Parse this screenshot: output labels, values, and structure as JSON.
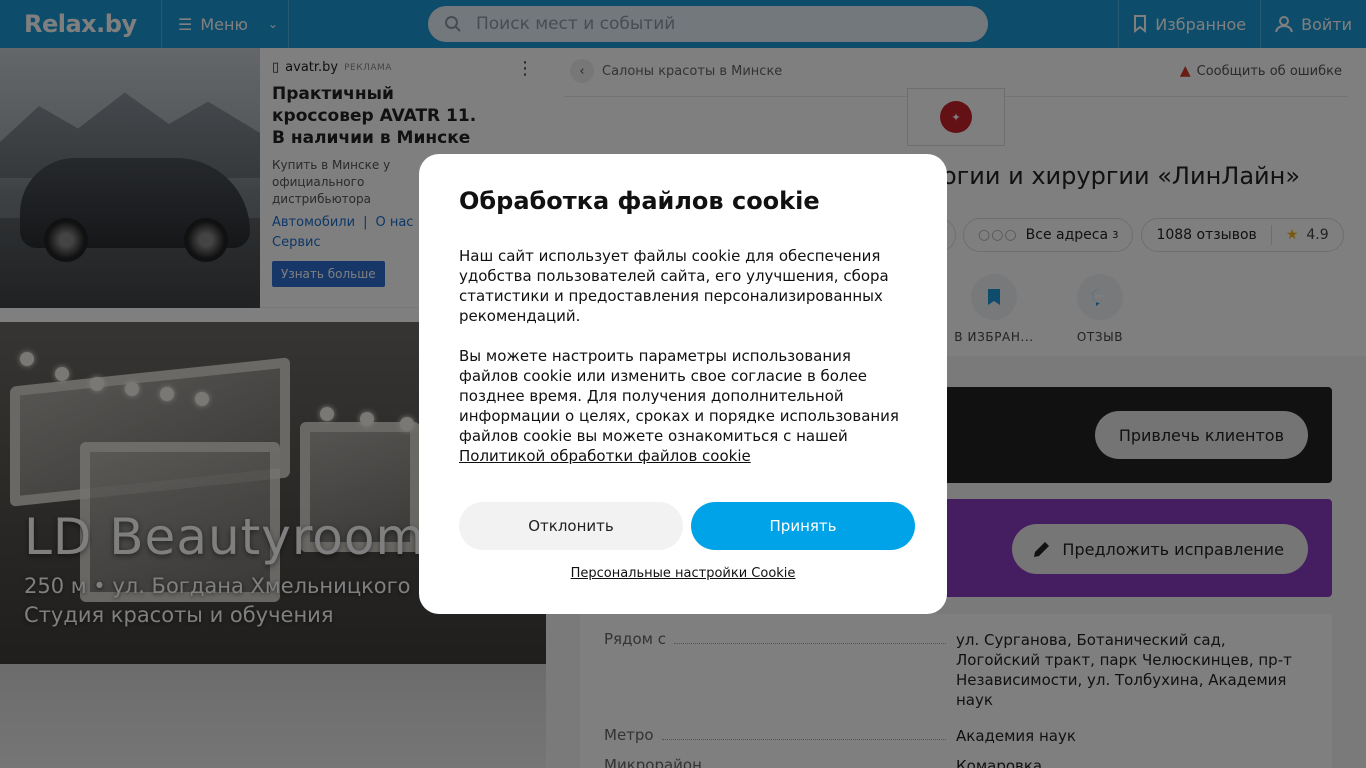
{
  "header": {
    "logo": "Relax.by",
    "menu_label": "Меню",
    "search_placeholder": "Поиск мест и событий",
    "favorites_label": "Избранное",
    "login_label": "Войти"
  },
  "ad": {
    "source": "avatr.by",
    "tag": "РЕКЛАМА",
    "title": "Практичный кроссовер AVATR 11. В наличии в Минске",
    "description": "Купить в Минске у официального дистрибьютора АВТОВЕК лет",
    "links": [
      "Автомобили",
      "О нас",
      "Сервис"
    ],
    "cta": "Узнать больше"
  },
  "feature": {
    "title": "LD Beautyroom",
    "subtitle_line1": "250 м • ул. Богдана Хмельницкого",
    "subtitle_line2": "Студия красоты и обучения"
  },
  "place": {
    "breadcrumb": "Салоны красоты в Минске",
    "report": "Сообщить об ошибке",
    "title": "огии и хирургии «ЛинЛайн»",
    "chips": {
      "addresses_label": "Все адреса",
      "addresses_count": "3",
      "reviews": "1088 отзывов",
      "rating": "4.9"
    },
    "actions": {
      "favorite": "В ИЗБРАН...",
      "review": "ОТЗЫВ"
    },
    "promo_dark_button": "Привлечь клиентов",
    "promo_purple_button": "Предложить исправление",
    "info": {
      "nearby_label": "Рядом с",
      "nearby_value": "ул. Сурганова, Ботанический сад, Логойский тракт, парк Челюскинцев, пр-т Независимости, ул. Толбухина, Академия наук",
      "metro_label": "Метро",
      "metro_value": "Академия наук",
      "district_label": "Микрорайон",
      "district_value": "Комаровка"
    }
  },
  "cookie": {
    "title": "Обработка файлов cookie",
    "para1": "Наш сайт использует файлы cookie для обеспечения удобства пользователей сайта, его улучшения, сбора статистики и предоставления персонализированных рекомендаций.",
    "para2": "Вы можете настроить параметры использования файлов cookie или изменить свое согласие в более позднее время. Для получения дополнительной информации о целях, сроках и порядке использования файлов cookie вы можете ознакомиться с нашей",
    "policy_link": "Политикой обработки файлов cookie",
    "decline": "Отклонить",
    "accept": "Принять",
    "personal": "Персональные настройки Cookie"
  },
  "colors": {
    "header_bg": "#1a9ad6",
    "accept_bg": "#00a3e8",
    "promo_purple": "#8b3cc5",
    "promo_dark": "#222222"
  }
}
